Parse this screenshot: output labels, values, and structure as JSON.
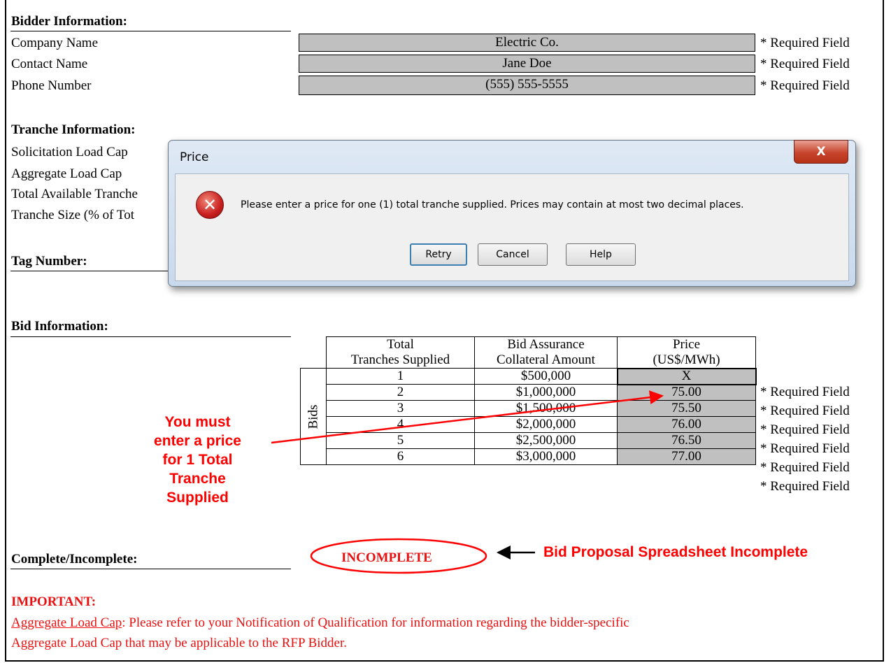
{
  "bidder": {
    "heading": "Bidder Information:",
    "fields": [
      {
        "label": "Company Name",
        "value": "Electric Co.",
        "note": "* Required Field"
      },
      {
        "label": "Contact Name",
        "value": "Jane Doe",
        "note": "* Required Field"
      },
      {
        "label": "Phone Number",
        "value": "(555) 555-5555",
        "note": "* Required Field"
      }
    ]
  },
  "tranche": {
    "heading": "Tranche Information:",
    "labels": [
      "Solicitation Load Cap",
      "Aggregate Load Cap",
      "Total Available Tranche",
      "Tranche Size (% of Tot"
    ]
  },
  "tag": {
    "heading": "Tag Number:"
  },
  "dialog": {
    "title": "Price",
    "close_label": "X",
    "message": "Please enter a price for one (1) total tranche supplied.  Prices may contain at most two decimal places.",
    "retry_label": "Retry",
    "cancel_label": "Cancel",
    "help_label": "Help",
    "error_icon_glyph": "✕"
  },
  "bid": {
    "heading": "Bid Information:",
    "col_headers": [
      "Total\nTranches Supplied",
      "Bid Assurance\nCollateral Amount",
      "Price\n(US$/MWh)"
    ],
    "col_header_lines": [
      [
        "Total",
        "Tranches Supplied"
      ],
      [
        "Bid Assurance",
        "Collateral Amount"
      ],
      [
        "Price",
        "(US$/MWh)"
      ]
    ],
    "side_label": "Bids",
    "rows": [
      {
        "tranches": "1",
        "collateral": "$500,000",
        "price": "X",
        "note": "* Required Field"
      },
      {
        "tranches": "2",
        "collateral": "$1,000,000",
        "price": "75.00",
        "note": "* Required Field"
      },
      {
        "tranches": "3",
        "collateral": "$1,500,000",
        "price": "75.50",
        "note": "* Required Field"
      },
      {
        "tranches": "4",
        "collateral": "$2,000,000",
        "price": "76.00",
        "note": "* Required Field"
      },
      {
        "tranches": "5",
        "collateral": "$2,500,000",
        "price": "76.50",
        "note": "* Required Field"
      },
      {
        "tranches": "6",
        "collateral": "$3,000,000",
        "price": "77.00",
        "note": "* Required Field"
      }
    ]
  },
  "annotation_left": {
    "lines": [
      "You must",
      "enter a price",
      "for 1 Total",
      "Tranche",
      "Supplied"
    ]
  },
  "status": {
    "heading": "Complete/Incomplete:",
    "value": "INCOMPLETE",
    "annotation": "Bid Proposal Spreadsheet Incomplete"
  },
  "important": {
    "heading": "IMPORTANT:",
    "link": "Aggregate Load Cap",
    "text1": ": Please refer to your Notification of Qualification for information regarding the bidder-specific",
    "text2": "Aggregate Load Cap that may be applicable to the RFP Bidder."
  },
  "colors": {
    "annotation_red": "#ff0000",
    "grey_field": "#c0c0c0",
    "important_red": "#e81010"
  }
}
